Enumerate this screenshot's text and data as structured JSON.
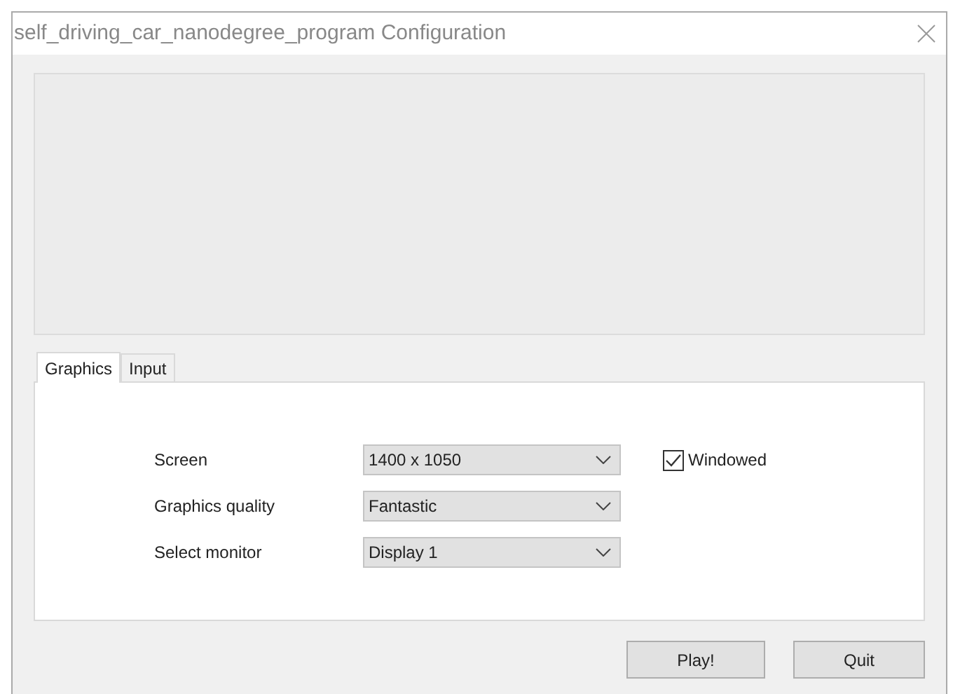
{
  "window": {
    "title": "self_driving_car_nanodegree_program Configuration"
  },
  "tabs": [
    {
      "label": "Graphics",
      "selected": true
    },
    {
      "label": "Input",
      "selected": false
    }
  ],
  "settings": [
    {
      "label": "Screen",
      "value": "1400 x 1050"
    },
    {
      "label": "Graphics quality",
      "value": "Fantastic"
    },
    {
      "label": "Select monitor",
      "value": "Display 1"
    }
  ],
  "windowed": {
    "label": "Windowed",
    "checked": true
  },
  "buttons": [
    "Play!",
    "Quit"
  ]
}
